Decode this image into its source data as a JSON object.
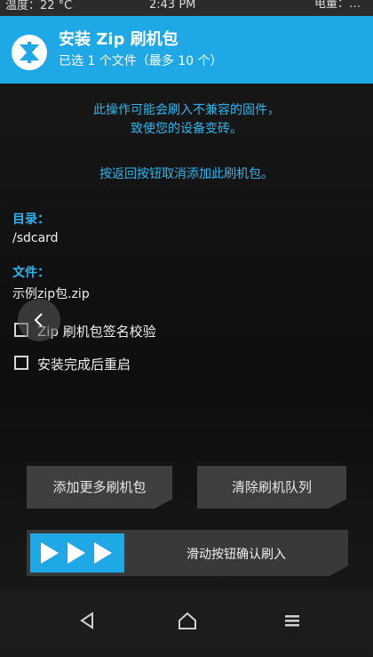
{
  "status_bar": {
    "temperature": "温度：22 °C",
    "time": "2:43 PM",
    "battery": "电量：…"
  },
  "header": {
    "title": "安装 Zip 刷机包",
    "subtitle": "已选 1 个文件（最多 10 个）",
    "accent_color": "#1fa8e6",
    "logo_icon": "twrp-logo-icon"
  },
  "warnings": {
    "line1": "此操作可能会刷入不兼容的固件，",
    "line2": "致使您的设备变砖。",
    "line3": "按返回按钮取消添加此刷机包。"
  },
  "directory": {
    "label": "目录：",
    "value": "/sdcard"
  },
  "file": {
    "label": "文件：",
    "value": "示例zip包.zip"
  },
  "options": [
    {
      "label": "Zip 刷机包签名校验",
      "checked": false
    },
    {
      "label": "安装完成后重启",
      "checked": false
    }
  ],
  "buttons": {
    "add_more": "添加更多刷机包",
    "clear_queue": "清除刷机队列"
  },
  "slider": {
    "label": "滑动按钮确认刷入",
    "icon": "triple-arrow-icon"
  },
  "nav": {
    "back_icon": "back-triangle-icon",
    "home_icon": "home-icon",
    "menu_icon": "menu-icon"
  }
}
